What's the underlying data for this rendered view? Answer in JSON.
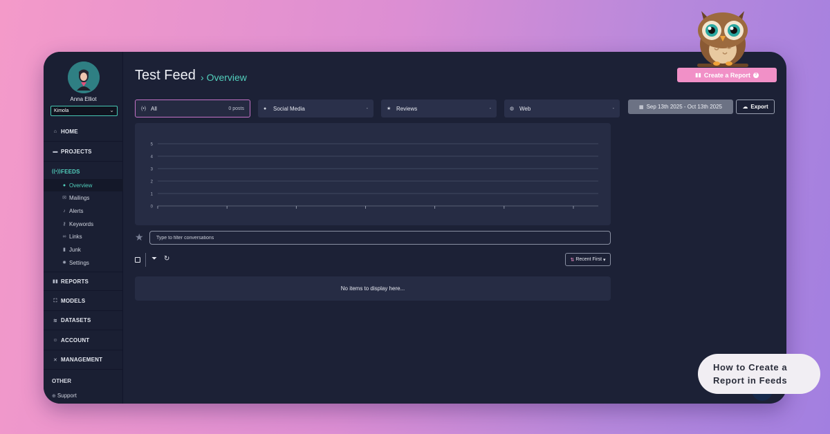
{
  "user": {
    "name": "Anna Elliot",
    "org": "Kimola"
  },
  "nav": {
    "home": "HOME",
    "projects": "PROJECTS",
    "feeds": "FEEDS",
    "feeds_sub": [
      "Overview",
      "Mailings",
      "Alerts",
      "Keywords",
      "Links",
      "Junk",
      "Settings"
    ],
    "reports": "REPORTS",
    "models": "MODELS",
    "datasets": "DATASETS",
    "account": "ACCOUNT",
    "management": "MANAGEMENT",
    "other": "OTHER",
    "support": "Support"
  },
  "header": {
    "title": "Test Feed",
    "crumb": "Overview",
    "create_report": "Create a Report"
  },
  "tabs": [
    {
      "label": "All",
      "count": "0 posts",
      "icon": "broadcast-icon"
    },
    {
      "label": "Social Media",
      "count": "-",
      "icon": "comments-icon"
    },
    {
      "label": "Reviews",
      "count": "-",
      "icon": "star-half-icon"
    },
    {
      "label": "Web",
      "count": "-",
      "icon": "globe-icon"
    }
  ],
  "date_range": "Sep 13th 2025 - Oct 13th 2025",
  "export_label": "Export",
  "search": {
    "placeholder": "Type to filter conversations"
  },
  "sort_label": "Recent First",
  "empty_message": "No items to display here...",
  "callout": {
    "line1": "How to Create a",
    "line2": "Report in Feeds"
  },
  "colors": {
    "accent": "#52d0bd",
    "brand_pink": "#f190c7",
    "panel": "#262c44",
    "background": "#1c2136"
  },
  "chart_data": {
    "type": "line",
    "yticks": [
      "0",
      "1",
      "2",
      "3",
      "4",
      "5"
    ],
    "ylim": [
      0,
      5
    ],
    "series": [],
    "grid": true
  }
}
